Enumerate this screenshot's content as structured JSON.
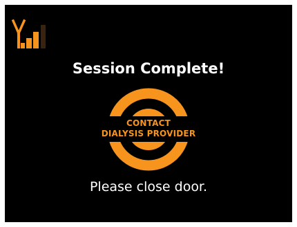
{
  "status_bar": {
    "signal_icon": "cellular-signal-icon",
    "signal_bars_active": 3,
    "signal_bars_total": 4
  },
  "title": "Session Complete!",
  "alert": {
    "icon": "alert-ring-icon",
    "line1": "CONTACT",
    "line2": "DIALYSIS PROVIDER"
  },
  "message": "Please close door.",
  "colors": {
    "screen_background": "#000000",
    "accent": "#f7941d",
    "inactive_bar": "#3a2410",
    "text": "#ffffff",
    "bezel": "#ffffff"
  }
}
